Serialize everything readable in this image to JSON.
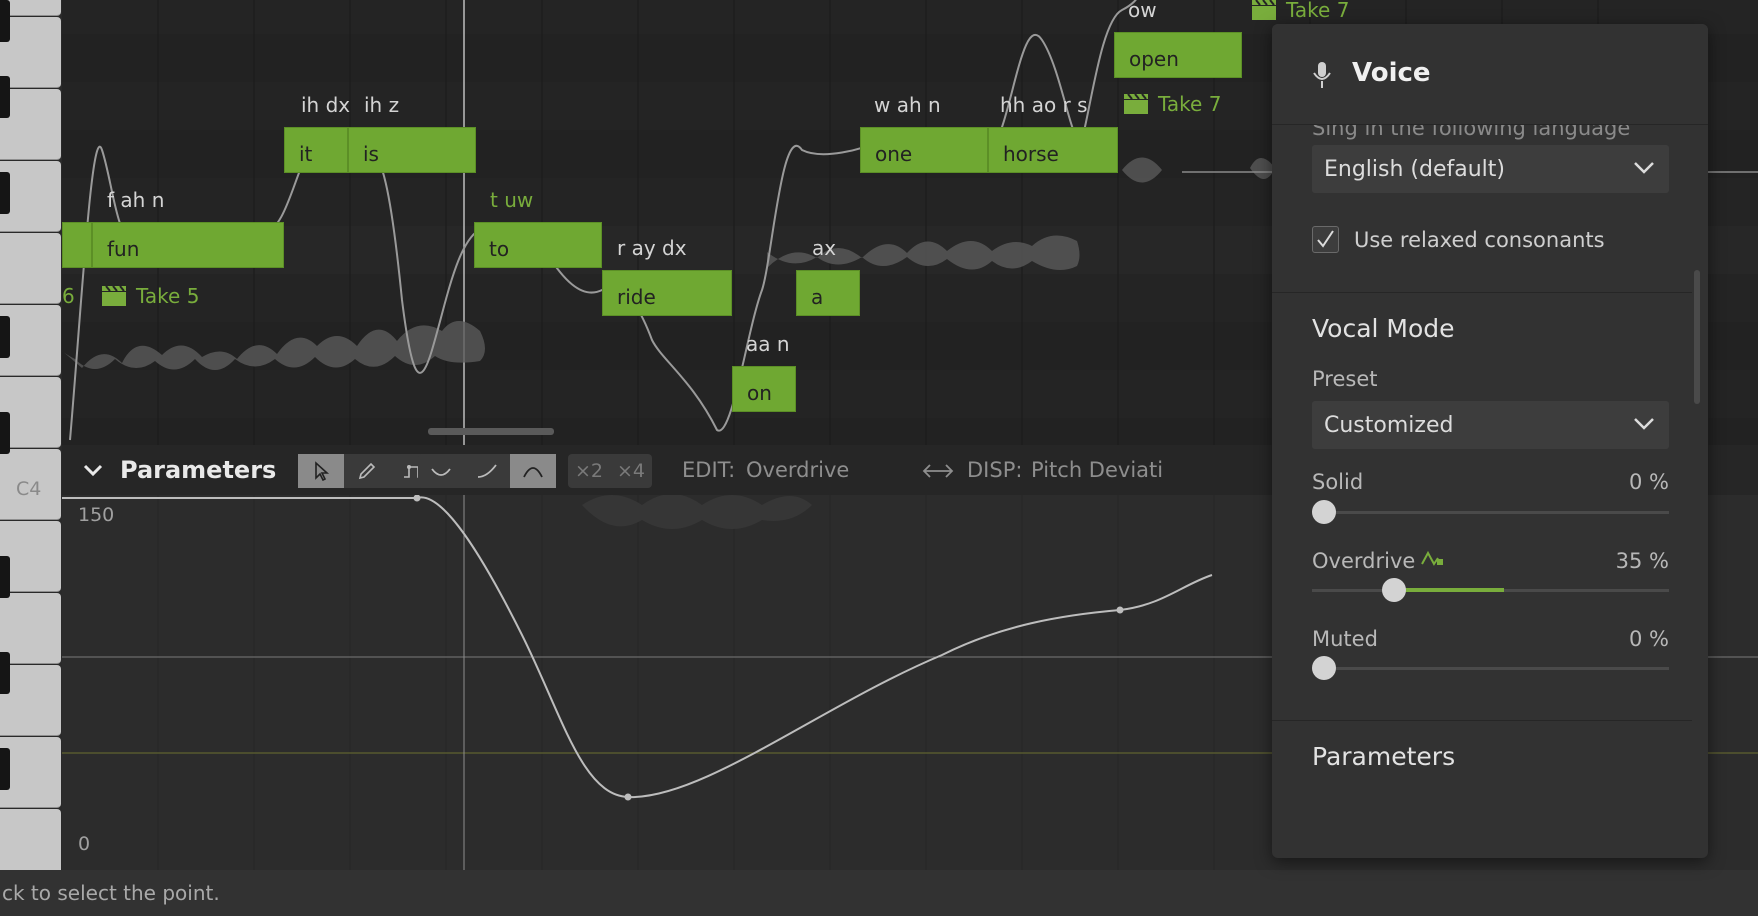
{
  "piano": {
    "c4_label": "C4"
  },
  "notes": [
    {
      "lyric": "fun"
    },
    {
      "lyric": "it"
    },
    {
      "lyric": "is"
    },
    {
      "lyric": "to"
    },
    {
      "lyric": "ride"
    },
    {
      "lyric": "on"
    },
    {
      "lyric": "a"
    },
    {
      "lyric": "one"
    },
    {
      "lyric": "horse"
    },
    {
      "lyric": "open"
    }
  ],
  "phonemes": [
    {
      "text": "f ah n"
    },
    {
      "text": "ih dx"
    },
    {
      "text": "ih z"
    },
    {
      "text": "t uw"
    },
    {
      "text": "r ay dx"
    },
    {
      "text": "aa n"
    },
    {
      "text": "ax"
    },
    {
      "text": "w ah n"
    },
    {
      "text": "hh ao r s"
    },
    {
      "text": "ow"
    }
  ],
  "takes": [
    {
      "label": "Take 5"
    },
    {
      "label": "Take 7"
    },
    {
      "label": "Take 7"
    },
    {
      "label": "6"
    }
  ],
  "parameters_bar": {
    "title": "Parameters",
    "multipliers": [
      "×2",
      "×4"
    ],
    "edit_label": "EDIT:",
    "edit_value": "Overdrive",
    "disp_label": "DISP:",
    "disp_value": "Pitch Deviati"
  },
  "curve": {
    "y_max": "150",
    "y_min": "0"
  },
  "status": {
    "text": "ck to select the point."
  },
  "voice_panel": {
    "title": "Voice",
    "language_label_cut": "Sing in the following language",
    "language_value": "English (default)",
    "relaxed_label": "Use relaxed consonants",
    "relaxed_checked": true,
    "vocal_mode_title": "Vocal Mode",
    "preset_label": "Preset",
    "preset_value": "Customized",
    "sliders": [
      {
        "label": "Solid",
        "value_text": "0 %",
        "value": 0
      },
      {
        "label": "Overdrive",
        "value_text": "35 %",
        "value": 35
      },
      {
        "label": "Muted",
        "value_text": "0 %",
        "value": 0
      }
    ],
    "parameters_title": "Parameters"
  },
  "colors": {
    "note": "#6fa832",
    "accent": "#79ad3c",
    "panel": "#323232"
  }
}
